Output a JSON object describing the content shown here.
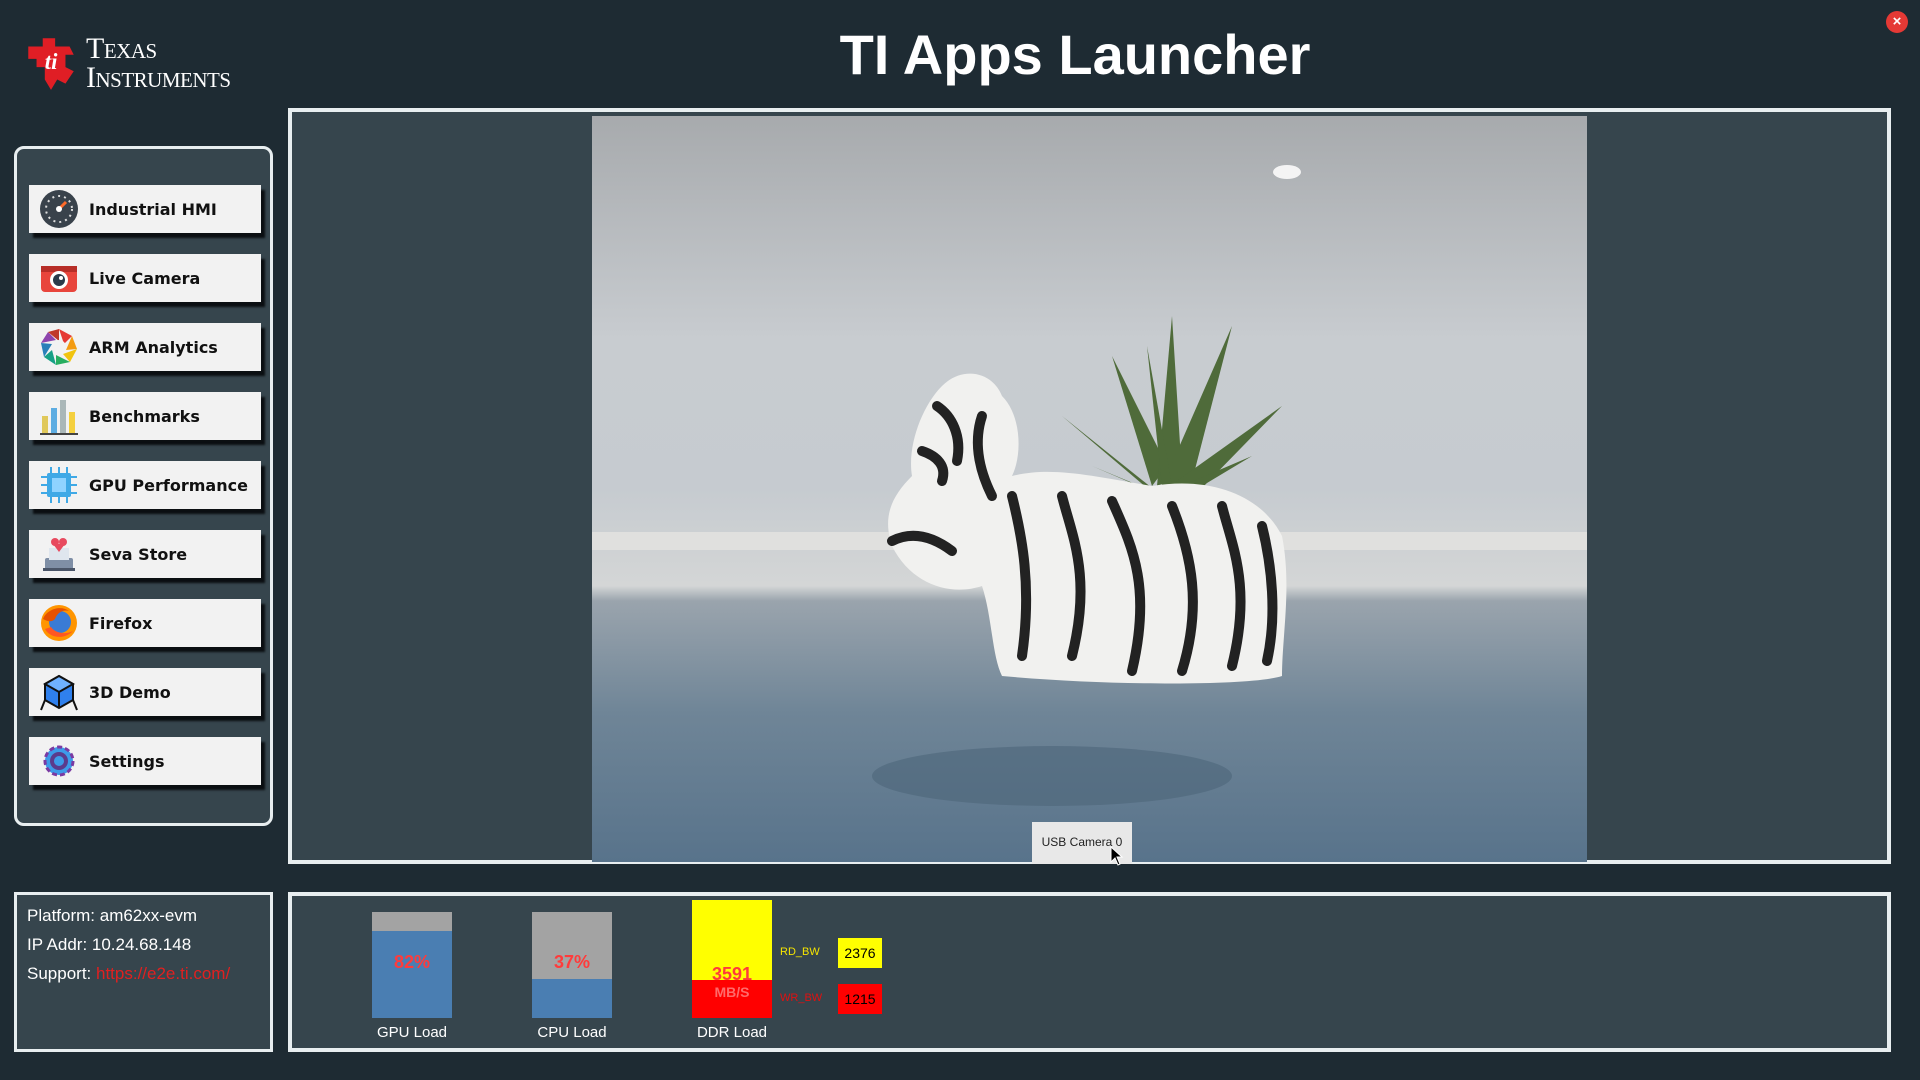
{
  "header": {
    "logo_line1": "Texas",
    "logo_line2": "Instruments",
    "title": "TI Apps Launcher",
    "close_symbol": "×"
  },
  "sidebar": {
    "items": [
      {
        "label": "Industrial HMI",
        "icon": "speedometer-icon"
      },
      {
        "label": "Live Camera",
        "icon": "camera-icon"
      },
      {
        "label": "ARM Analytics",
        "icon": "aperture-icon"
      },
      {
        "label": "Benchmarks",
        "icon": "bar-chart-icon"
      },
      {
        "label": "GPU Performance",
        "icon": "chip-icon"
      },
      {
        "label": "Seva Store",
        "icon": "store-icon"
      },
      {
        "label": "Firefox",
        "icon": "firefox-icon"
      },
      {
        "label": "3D Demo",
        "icon": "cube-icon"
      },
      {
        "label": "Settings",
        "icon": "gear-icon"
      }
    ]
  },
  "viewer": {
    "camera_tab_label": "USB Camera 0"
  },
  "info": {
    "platform": "Platform: am62xx-evm",
    "ip": "IP Addr: 10.24.68.148",
    "support_label": "Support: ",
    "support_link": "https://e2e.ti.com/"
  },
  "stats": {
    "gpu": {
      "label": "GPU Load",
      "percent_text": "82%",
      "load": 0.82
    },
    "cpu": {
      "label": "CPU Load",
      "percent_text": "37%",
      "load": 0.37
    },
    "ddr": {
      "label": "DDR Load",
      "value": "3591",
      "unit": "MB/S",
      "rd_label": "RD_BW",
      "rd_value": "2376",
      "wr_label": "WR_BW",
      "wr_value": "1215"
    }
  },
  "colors": {
    "background": "#1e2b33",
    "panel": "#36454d",
    "accent_red": "#e53935",
    "bar_blue": "#4a7eb2",
    "ddr_yellow": "#ffff00",
    "ddr_red": "#ff0000"
  }
}
